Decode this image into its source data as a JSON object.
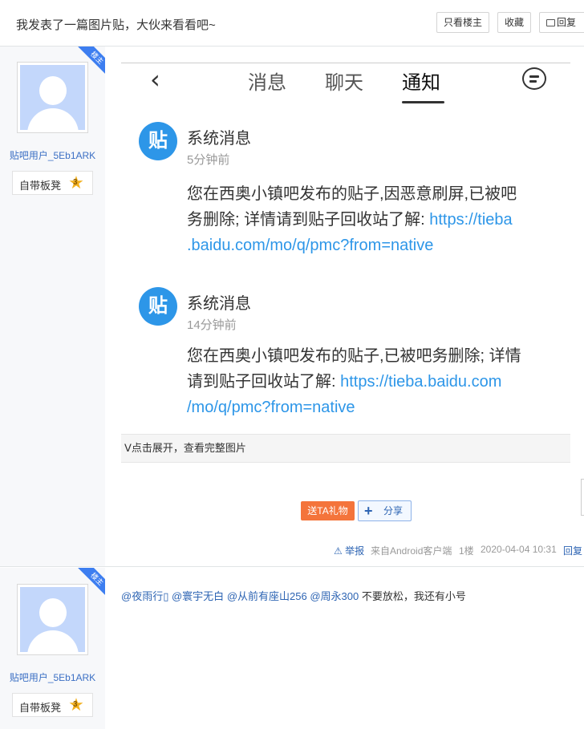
{
  "header": {
    "title": "我发表了一篇图片贴，大伙来看看吧~",
    "only_op_label": "只看楼主",
    "favorite_label": "收藏",
    "reply_label": "回复"
  },
  "posts": [
    {
      "author": "贴吧用户_5Eb1ARK",
      "louzhu_tag": "楼主",
      "badge_text": "自带板凳",
      "badge_level": "3",
      "screenshot": {
        "nav_back": "‹",
        "tabs": [
          "消息",
          "聊天",
          "通知"
        ],
        "messages": [
          {
            "logo": "贴",
            "title": "系统消息",
            "time": "5分钟前",
            "line1": "您在西奥小镇吧发布的贴子,因恶意刷屏,已被吧",
            "line2a": "务删除; 详情请到贴子回收站了解: ",
            "line2b": "https://tieba",
            "line3": ".baidu.com/mo/q/pmc?from=native"
          },
          {
            "logo": "贴",
            "title": "系统消息",
            "time": "14分钟前",
            "line1": "您在西奥小镇吧发布的贴子,已被吧务删除; 详情",
            "line2a": "请到贴子回收站了解: ",
            "line2b": "https://tieba.baidu.com",
            "line3": "/mo/q/pmc?from=native"
          }
        ]
      },
      "expand_label": "ᐯ点击展开，查看完整图片",
      "gift_label": "送TA礼物",
      "share_label": "分享",
      "report_label": "举报",
      "source": "来自Android客户端",
      "floor": "1楼",
      "datetime": "2020-04-04 10:31",
      "reply_label": "回复"
    },
    {
      "author": "贴吧用户_5Eb1ARK",
      "louzhu_tag": "楼主",
      "badge_text": "自带板凳",
      "badge_level": "3",
      "mentions": [
        "@夜雨行▯",
        "@寰宇无白",
        "@从前有座山256",
        "@周永300"
      ],
      "text": " 不要放松，我还有小号"
    }
  ],
  "colors": {
    "link_blue": "#2d64b3",
    "gift_orange": "#f4743b",
    "tieba_blue": "#2d96e8"
  }
}
